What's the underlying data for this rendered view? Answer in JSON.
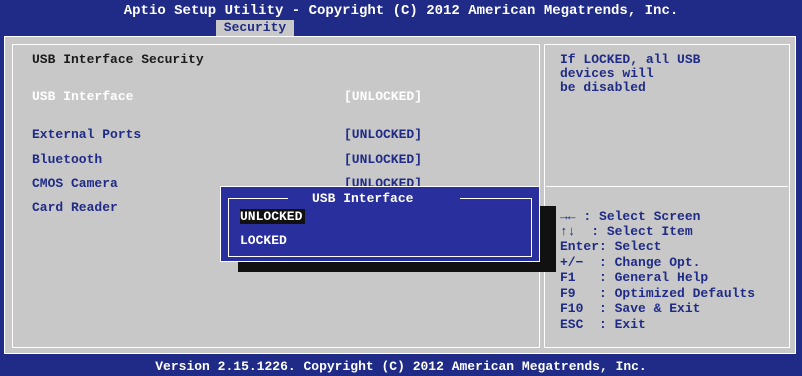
{
  "header": {
    "title": "Aptio Setup Utility - Copyright (C) 2012 American Megatrends, Inc.",
    "active_tab": "Security"
  },
  "main": {
    "section_title": "USB Interface Security",
    "settings": [
      {
        "label": "USB Interface",
        "value": "[UNLOCKED]"
      },
      {
        "label": "External Ports",
        "value": "[UNLOCKED]"
      },
      {
        "label": "Bluetooth",
        "value": "[UNLOCKED]"
      },
      {
        "label": "CMOS Camera",
        "value": "[UNLOCKED]"
      },
      {
        "label": "Card Reader",
        "value": ""
      }
    ]
  },
  "help": {
    "line1": "If LOCKED, all USB",
    "line2": "devices will",
    "line3": "be disabled"
  },
  "keys": [
    {
      "key": "→←",
      "desc": ": Select Screen"
    },
    {
      "key": "↑↓",
      "desc": ": Select Item"
    },
    {
      "key": "Enter:",
      "desc": "Select"
    },
    {
      "key": "+/−",
      "desc": ": Change Opt."
    },
    {
      "key": "F1",
      "desc": ": General Help"
    },
    {
      "key": "F9",
      "desc": ": Optimized Defaults"
    },
    {
      "key": "F10",
      "desc": ": Save & Exit"
    },
    {
      "key": "ESC",
      "desc": ": Exit"
    }
  ],
  "popup": {
    "title": "USB Interface",
    "options": [
      "UNLOCKED",
      "LOCKED"
    ]
  },
  "footer": {
    "version": "Version 2.15.1226. Copyright (C) 2012 American Megatrends, Inc."
  }
}
